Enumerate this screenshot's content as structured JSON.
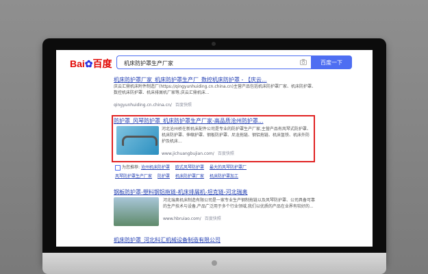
{
  "search": {
    "logo_text": "Bai",
    "logo_paw": "du",
    "logo_suffix": "百度",
    "query": "机床防护罩生产厂家",
    "button_label": "百度一下"
  },
  "results": [
    {
      "title": "机床防护罩厂家_机床防护罩生产厂_数控机床防护罩 - 【庆云...",
      "text": "庆云汇鼎机床附件制造厂(https://qingyunhuiding.cn.china.cn)主营产品包括机床防护罩厂家、机床防护罩、数控机床防护罩、机床排屑机厂家等,庆云汇鼎机床...",
      "url": "qingyunhuiding.cn.china.cn/",
      "snapshot": "百度快照"
    },
    {
      "title": "防护罩_风琴防护罩_机床防护罩生产厂家-高品质沧州防护罩...",
      "text": "河北沧州桥在新机床配件公司是专业的防护罩生产厂家,主营产品有风琴式防护罩、机床防护罩、伸缩护罩、钢板防护罩、尼龙拖链、钢铝拖链、机床盔铁、机床外防护及机床...",
      "url": "www.jichuangbujian.com/",
      "snapshot": "百度快照"
    },
    {
      "title": "钢板防护罩-塑料钢铝拖链-机床排屑机-坦克链-河北瑞奥",
      "text": "河北瑞奥机床制造有限公司是一家专业生产钢制拖链以及风琴防护罩、公司具备可靠的生产技术与设备,产品广泛用于多个行业领域,我们以优质的产品在业界有较好的...",
      "url": "www.hbruiao.com/",
      "snapshot": "百度快照"
    },
    {
      "title": "机床防护罩_河北科汇机械设备制造有限公司"
    }
  ],
  "related": {
    "label": "为您推荐:",
    "links": [
      "沧州机床防护罩",
      "欧式风琴防护罩",
      "最大的风琴防护罩厂",
      "风琴防护罩生产厂家",
      "防护罩",
      "机床防护罩厂家",
      "机床防护罩加工"
    ]
  }
}
